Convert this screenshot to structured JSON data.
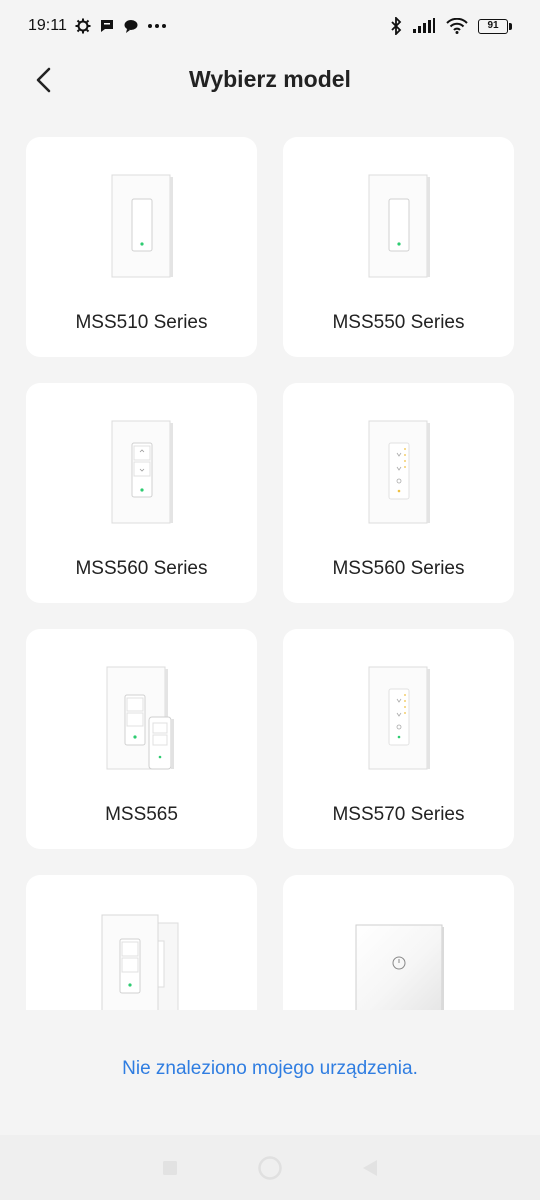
{
  "status_bar": {
    "time": "19:11",
    "battery": "91",
    "left_icons": [
      "settings-gear-icon",
      "message-icon",
      "chat-bubble-icon",
      "more-dots-icon"
    ],
    "right_icons": [
      "bluetooth-icon",
      "signal-icon",
      "wifi-icon",
      "battery-icon"
    ]
  },
  "header": {
    "title": "Wybierz model",
    "back_icon": "chevron-left-icon"
  },
  "models": [
    {
      "label": "MSS510 Series",
      "image": "single-switch"
    },
    {
      "label": "MSS550 Series",
      "image": "single-switch"
    },
    {
      "label": "MSS560 Series",
      "image": "double-switch"
    },
    {
      "label": "MSS560 Series",
      "image": "dimmer-switch"
    },
    {
      "label": "MSS565",
      "image": "switch-with-remote"
    },
    {
      "label": "MSS570 Series",
      "image": "dimmer-switch"
    },
    {
      "label": "",
      "image": "double-switch-pair"
    },
    {
      "label": "",
      "image": "square-touch-panel"
    }
  ],
  "footer": {
    "not_found_link": "Nie znaleziono mojego urządzenia."
  },
  "colors": {
    "background": "#f4f4f4",
    "card": "#ffffff",
    "link": "#2f7de1",
    "led": "#2ecc71"
  },
  "nav_bar": {
    "buttons": [
      "recents-square-icon",
      "home-circle-icon",
      "back-triangle-icon"
    ]
  }
}
